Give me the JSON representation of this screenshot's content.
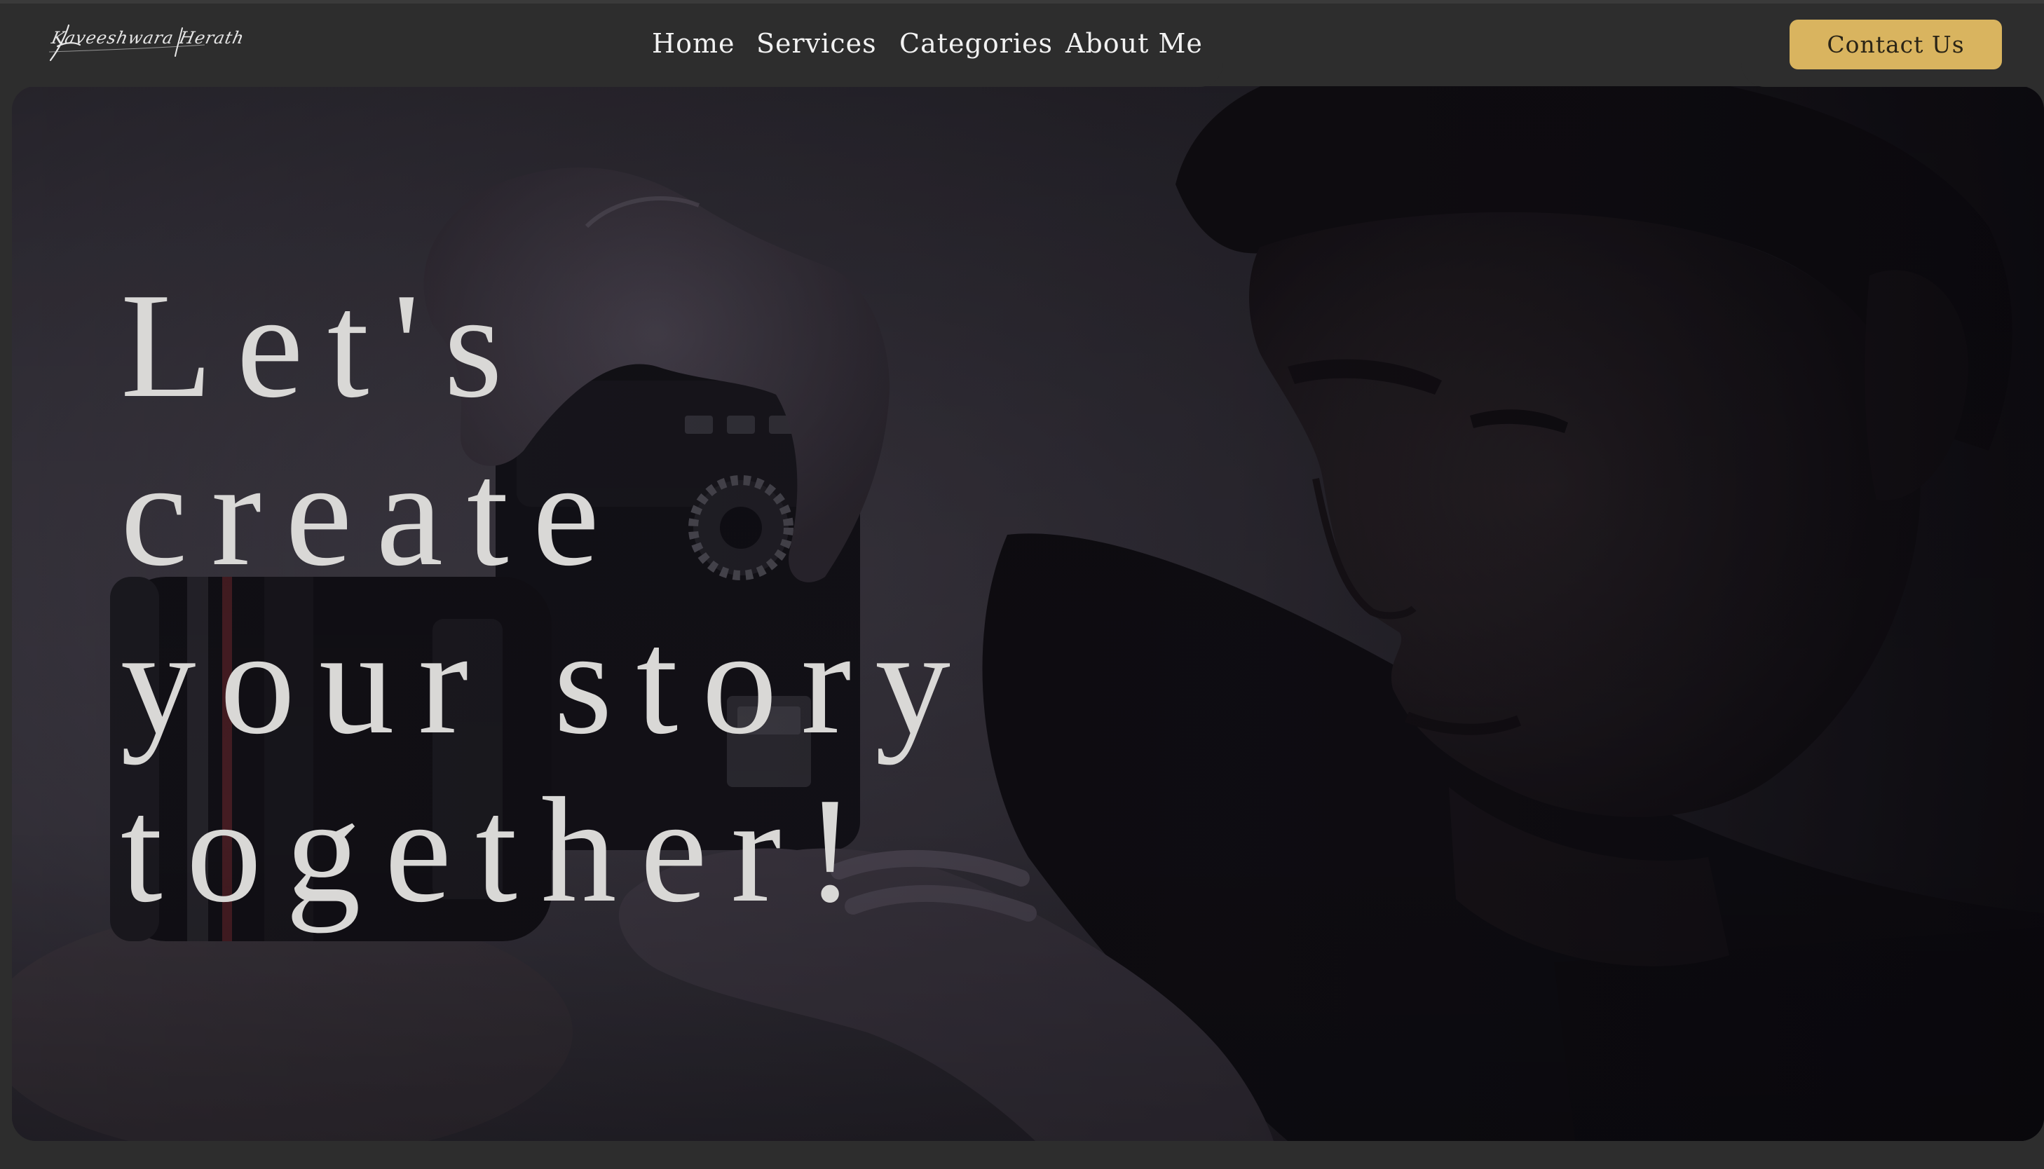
{
  "brand": {
    "logo_text": "Kaveeshwara Herath"
  },
  "nav": {
    "items": [
      {
        "label": "Home"
      },
      {
        "label": "Services"
      },
      {
        "label": "Categories"
      },
      {
        "label": "About Me"
      }
    ]
  },
  "header": {
    "contact_label": "Contact Us"
  },
  "hero": {
    "headline_lines": [
      "Let's",
      "create",
      "your story",
      "together!"
    ]
  },
  "colors": {
    "background": "#2d2d2d",
    "accent": "#d9b45f",
    "headline": "#d9d8d6"
  }
}
